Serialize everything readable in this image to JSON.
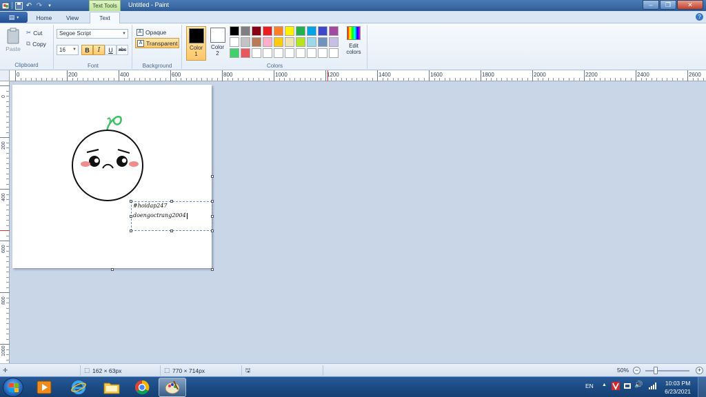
{
  "titlebar": {
    "context_tab": "Text Tools",
    "window_title": "Untitled - Paint"
  },
  "tabs": [
    {
      "label": "Home"
    },
    {
      "label": "View"
    },
    {
      "label": "Text"
    }
  ],
  "ribbon": {
    "clipboard": {
      "paste": "Paste",
      "cut": "Cut",
      "copy": "Copy",
      "label": "Clipboard"
    },
    "font": {
      "family": "Segoe Script",
      "size": "16",
      "bold": "B",
      "italic": "I",
      "underline": "U",
      "strike": "abc",
      "label": "Font"
    },
    "background": {
      "opaque": "Opaque",
      "transparent": "Transparent",
      "label": "Background"
    },
    "colors": {
      "color1_line1": "Color",
      "color1_line2": "1",
      "color2_line1": "Color",
      "color2_line2": "2",
      "edit_line1": "Edit",
      "edit_line2": "colors",
      "label": "Colors",
      "color1": "#000000",
      "color2": "#ffffff",
      "palette": [
        "#000000",
        "#7f7f7f",
        "#880015",
        "#ed1c24",
        "#ff7f27",
        "#fff200",
        "#22b14c",
        "#00a2e8",
        "#3f48cc",
        "#a349a4",
        "#ffffff",
        "#c3c3c3",
        "#b97a57",
        "#ffaec9",
        "#ffc90e",
        "#efe4b0",
        "#b5e61d",
        "#99d9ea",
        "#7092be",
        "#c8bfe7",
        "#3fd16a",
        "#e8595f",
        "#ffffff",
        "#ffffff",
        "#ffffff",
        "#ffffff",
        "#ffffff",
        "#ffffff",
        "#ffffff",
        "#ffffff"
      ]
    }
  },
  "ruler_h": [
    "0",
    "200",
    "400",
    "600",
    "800",
    "1000",
    "1200",
    "1400",
    "1600",
    "1800",
    "2000",
    "2200",
    "2400",
    "2600"
  ],
  "ruler_v": [
    "0",
    "200",
    "400",
    "600",
    "800",
    "1000"
  ],
  "textbox": {
    "line1": "#hoidap247",
    "line2": "doengoctrang2004"
  },
  "status": {
    "selection": "162 × 63px",
    "image_size": "770 × 714px",
    "zoom": "50%"
  },
  "taskbar": {
    "language": "EN",
    "time": "10:03 PM",
    "date": "6/23/2021"
  }
}
